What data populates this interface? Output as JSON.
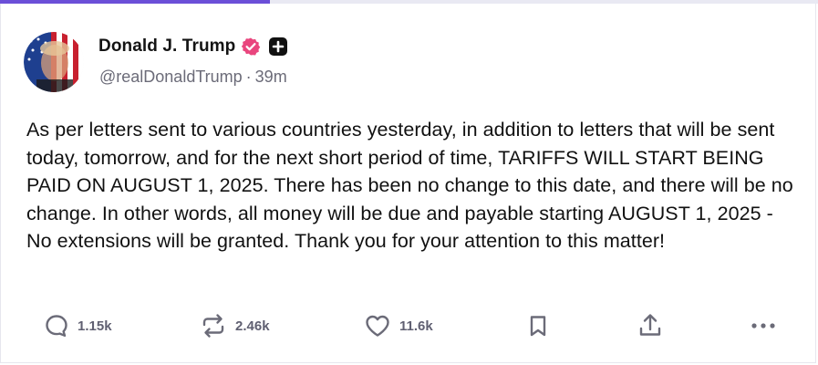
{
  "page": {
    "progress_fraction": 0.33,
    "accent": "#6b4fd8"
  },
  "author": {
    "name": "Donald J. Trump",
    "handle": "@realDonaldTrump",
    "separator": "·",
    "time": "39m",
    "verified_icon": "verified-badge-icon",
    "verified_color": "#e9467e",
    "plus_icon": "plus-square-icon"
  },
  "post": {
    "text": "As per letters sent to various countries yesterday, in addition to letters that will be sent today, tomorrow, and for the next short period of time, TARIFFS WILL START BEING PAID ON AUGUST 1, 2025. There has been no change to this date, and there will be no change. In other words, all money will be due and payable starting AUGUST 1, 2025 - No extensions will be granted. Thank you for your attention to this matter!"
  },
  "actions": {
    "reply": {
      "icon": "reply-icon",
      "count": "1.15k"
    },
    "retruth": {
      "icon": "repost-icon",
      "count": "2.46k"
    },
    "like": {
      "icon": "heart-icon",
      "count": "11.6k"
    },
    "bookmark": {
      "icon": "bookmark-icon"
    },
    "share": {
      "icon": "share-icon"
    },
    "more": {
      "icon": "more-icon"
    }
  }
}
